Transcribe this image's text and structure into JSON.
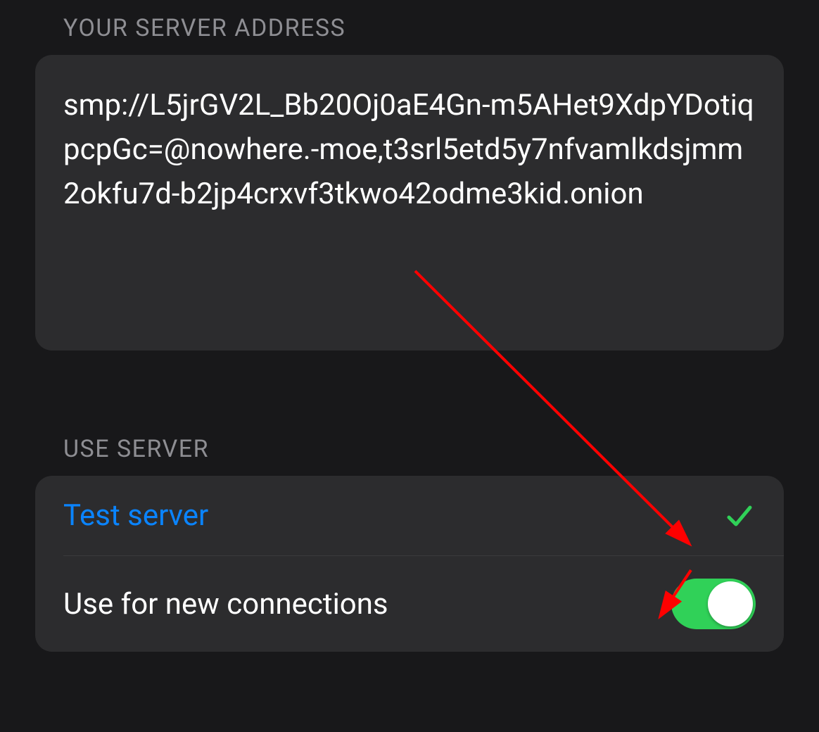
{
  "sections": {
    "address": {
      "header": "Your Server Address",
      "value": "smp://L5jrGV2L_Bb20Oj0aE4Gn-m5AHet9XdpYDotiqpcpGc=@nowhere.-moe,t3srl5etd5y7nfvamlkdsjmm2okfu7d-b2jp4crxvf3tkwo42odme3kid.onion"
    },
    "use_server": {
      "header": "Use Server",
      "test_label": "Test server",
      "test_status": "success",
      "toggle_label": "Use for new connections",
      "toggle_on": true
    }
  },
  "colors": {
    "link": "#0a84ff",
    "success": "#30d158",
    "annotation": "#ff0000"
  }
}
